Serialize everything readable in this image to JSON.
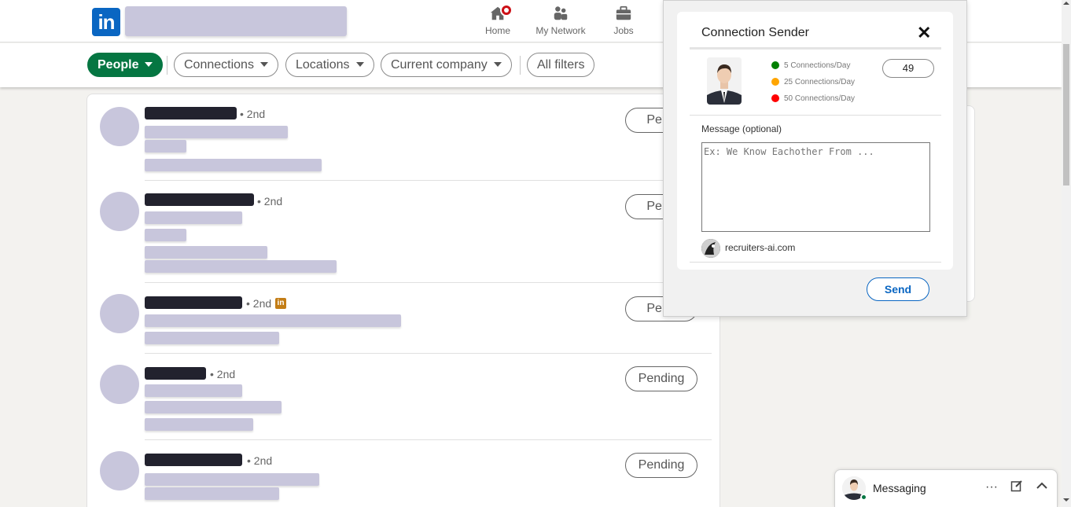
{
  "nav": {
    "logo": "in",
    "items": [
      {
        "label": "Home",
        "icon": "home-icon",
        "badge": true
      },
      {
        "label": "My Network",
        "icon": "network-icon"
      },
      {
        "label": "Jobs",
        "icon": "briefcase-icon"
      }
    ]
  },
  "filters": {
    "people": "People",
    "connections": "Connections",
    "locations": "Locations",
    "current_company": "Current company",
    "all_filters": "All filters"
  },
  "results": [
    {
      "degree": "• 2nd",
      "action": "Pending",
      "action_visible": "Pend"
    },
    {
      "degree": "• 2nd",
      "action": "Pending",
      "action_visible": "Pend"
    },
    {
      "degree": "• 2nd",
      "action": "Pending",
      "action_visible": "Pend",
      "premium_badge": true
    },
    {
      "degree": "• 2nd",
      "action": "Pending"
    },
    {
      "degree": "• 2nd",
      "action": "Pending"
    }
  ],
  "popup": {
    "title": "Connection Sender",
    "close": "✕",
    "options": [
      {
        "label": "5 Connections/Day",
        "color": "#008000"
      },
      {
        "label": "25 Connections/Day",
        "color": "#ffa500"
      },
      {
        "label": "50 Connections/Day",
        "color": "#ff0000"
      }
    ],
    "count_value": "49",
    "message_label": "Message (optional)",
    "message_placeholder": "Ex: We Know Eachother From ...",
    "brand": "recruiters-ai.com",
    "send": "Send"
  },
  "messaging": {
    "title": "Messaging"
  },
  "colors": {
    "brand_blue": "#0a66c2",
    "people_green": "#057642",
    "blur_fill": "#c8c6dc",
    "name_blur": "#22222e"
  }
}
